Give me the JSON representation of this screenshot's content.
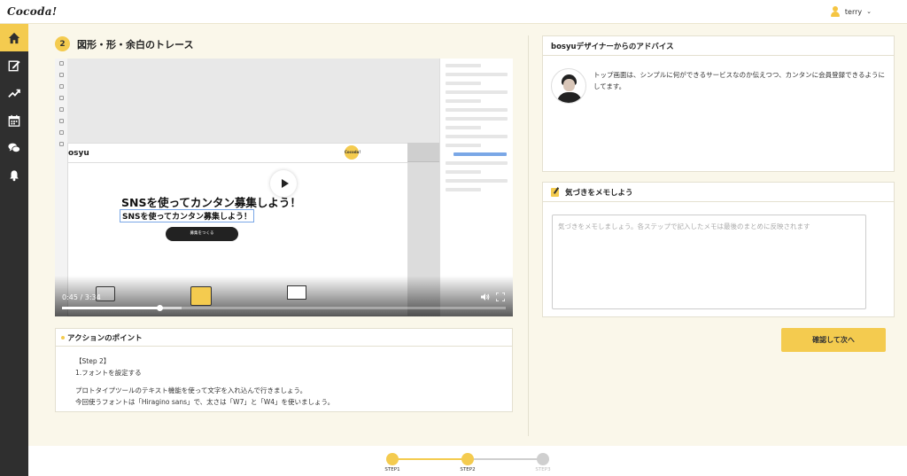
{
  "app": {
    "logo": "Cocoda!",
    "user_name": "terry"
  },
  "sidebar": {
    "items": [
      {
        "name": "home",
        "icon": "home-icon",
        "active": true
      },
      {
        "name": "edit",
        "icon": "edit-icon",
        "active": false
      },
      {
        "name": "trend",
        "icon": "trend-icon",
        "active": false
      },
      {
        "name": "calendar",
        "icon": "calendar-icon",
        "active": false
      },
      {
        "name": "chat",
        "icon": "chat-icon",
        "active": false
      },
      {
        "name": "notifications",
        "icon": "bell-icon",
        "active": false
      }
    ]
  },
  "step": {
    "number": "2",
    "title": "図形・形・余白のトレース"
  },
  "video": {
    "time": "0:45 / 3:34",
    "progress": 0.22,
    "buffered": 0.27,
    "mock": {
      "brand": "osyu",
      "logo": "Cocoda!",
      "headline": "SNSを使ってカンタン募集しよう！",
      "subheadline": "SNSを使ってカンタン募集しよう！",
      "button": "募集をつくる"
    }
  },
  "action": {
    "title": "アクションのポイント",
    "lines": [
      "【Step 2】",
      "1.フォントを設定する",
      "",
      "プロトタイプツールのテキスト機能を使って文字を入れ込んで行きましょう。",
      "今回使うフォントは「Hiragino sans」で、太さは「W7」と「W4」を使いましょう。"
    ]
  },
  "advice": {
    "title": "bosyuデザイナーからのアドバイス",
    "text": "トップ画面は、シンプルに何ができるサービスなのか伝えつつ、カンタンに会員登録できるようにしてます。"
  },
  "memo": {
    "title": "気づきをメモしよう",
    "placeholder": "気づきをメモしましょう。各ステップで記入したメモは最後のまとめに反映されます"
  },
  "next_button": "確認して次へ",
  "stepper": {
    "steps": [
      "STEP1",
      "STEP2",
      "STEP3"
    ],
    "current": 2
  },
  "colors": {
    "accent": "#f4cb4f",
    "sidebar": "#2f2f2f",
    "background": "#faf7ea"
  }
}
